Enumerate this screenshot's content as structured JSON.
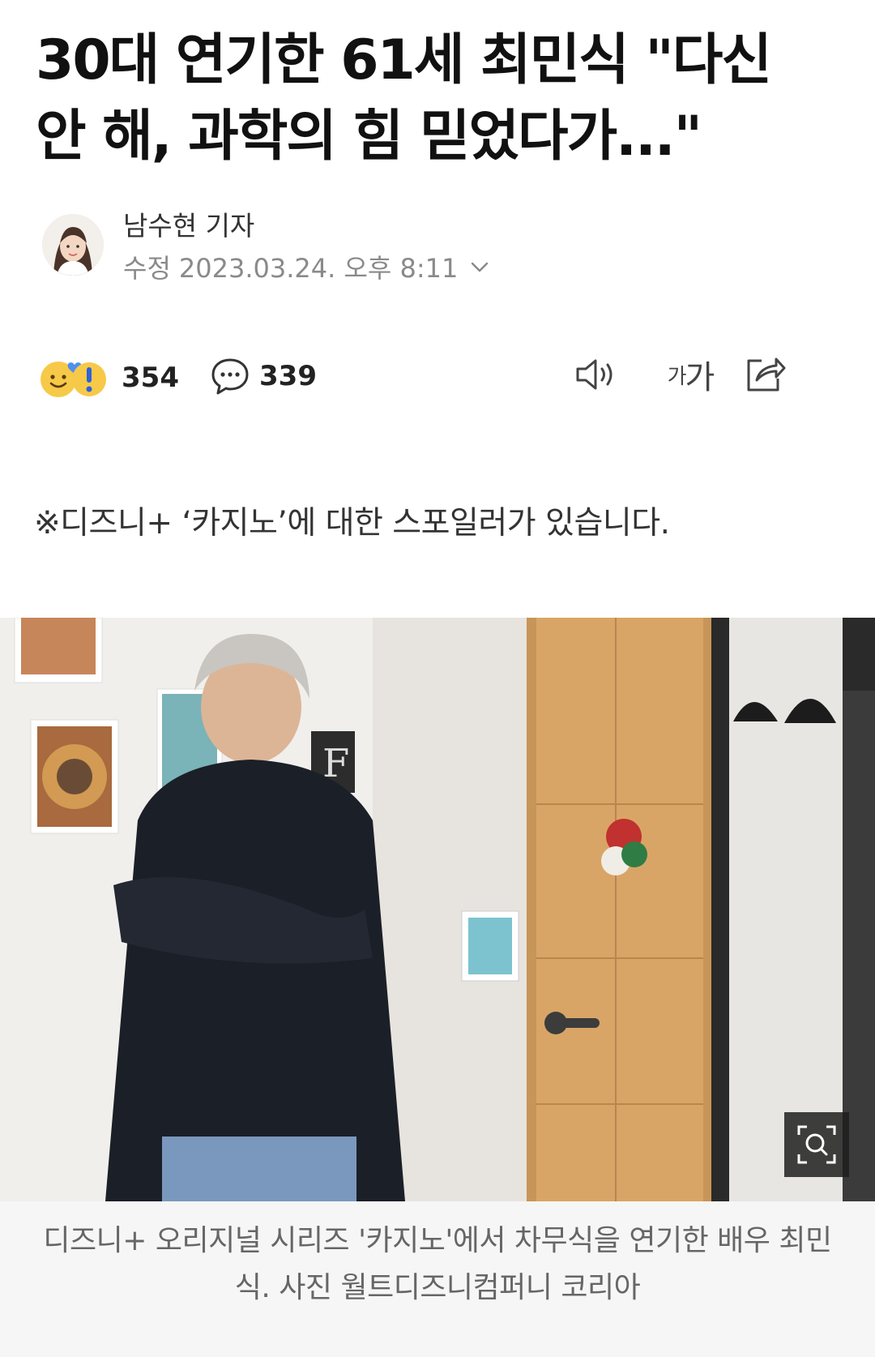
{
  "article": {
    "headline": "30대 연기한 61세 최민식 \"다신 안 해, 과학의 힘 믿었다가...\"",
    "reporter": "남수현 기자",
    "modified_label": "수정",
    "modified_time": "2023.03.24. 오후 8:11",
    "spoiler_notice": "※디즈니+ ‘카지노’에 대한 스포일러가 있습니다.",
    "photo_caption": "디즈니+ 오리지널 시리즈 '카지노'에서 차무식을 연기한 배우 최민식. 사진 월트디즈니컴퍼니 코리아"
  },
  "toolbar": {
    "reaction_count": "354",
    "comment_count": "339",
    "font_size_small": "가",
    "font_size_large": "가",
    "icons": {
      "reaction": [
        "smile-emoji-icon",
        "heart-icon",
        "exclamation-icon"
      ],
      "comment": "speech-bubble-icon",
      "tts": "speaker-icon",
      "share": "share-icon",
      "zoom": "zoom-icon",
      "chevron": "chevron-down-icon"
    }
  },
  "colors": {
    "headline": "#111111",
    "meta": "#8a8a8a",
    "caption_bg": "#f6f6f6",
    "emoji_yellow": "#f7c948",
    "heart_blue": "#4f8ff0"
  }
}
